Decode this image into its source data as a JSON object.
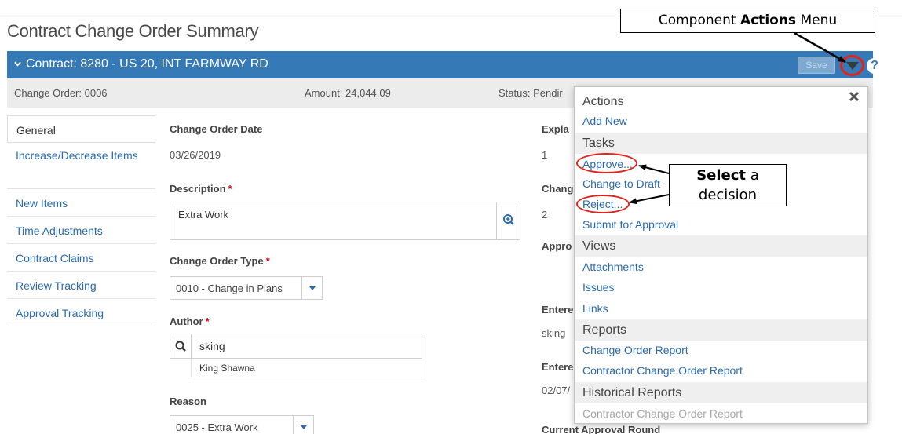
{
  "page": {
    "title": "Contract Change Order Summary"
  },
  "contract_bar": {
    "title": "Contract: 8280 - US 20, INT FARMWAY RD",
    "save_label": "Save",
    "help_symbol": "?"
  },
  "info_bar": {
    "change_order": "Change Order: 0006",
    "amount": "Amount: 24,044.09",
    "status": "Status: Pendir"
  },
  "nav": [
    {
      "label": "General"
    },
    {
      "label": "Increase/Decrease Items"
    },
    {
      "label": "New Items"
    },
    {
      "label": "Time Adjustments"
    },
    {
      "label": "Contract Claims"
    },
    {
      "label": "Review Tracking"
    },
    {
      "label": "Approval Tracking"
    }
  ],
  "form": {
    "change_order_date_label": "Change Order Date",
    "change_order_date": "03/26/2019",
    "description_label": "Description",
    "description": "Extra Work",
    "type_label": "Change Order Type",
    "type_value": "0010 - Change in Plans",
    "author_label": "Author",
    "author_value": "sking",
    "author_name": "King Shawna",
    "reason_label": "Reason",
    "reason_value": "0025 - Extra Work",
    "required_mark": "*"
  },
  "right_column": {
    "explanation_label": "Expla",
    "explanation_value": "1",
    "change_label": "Chang",
    "change_value": "2",
    "approval_label": "Appro",
    "entered_by_label": "Entere",
    "entered_by_value": "sking",
    "entered_date_label": "Entere",
    "entered_date_value": "02/07/",
    "round_label": "Current Approval Round"
  },
  "actions_menu": {
    "header": "Actions",
    "actions": [
      "Add New"
    ],
    "tasks_header": "Tasks",
    "tasks": [
      "Approve...",
      "Change to Draft",
      "Reject...",
      "Submit for Approval"
    ],
    "views_header": "Views",
    "views": [
      "Attachments",
      "Issues",
      "Links"
    ],
    "reports_header": "Reports",
    "reports": [
      "Change Order Report",
      "Contractor Change Order Report"
    ],
    "historical_header": "Historical Reports",
    "historical": [
      "Contractor Change Order Report"
    ]
  },
  "callouts": {
    "menu_prefix": "Component ",
    "menu_bold": "Actions",
    "menu_suffix": " Menu",
    "select_bold": "Select",
    "select_rest": " a",
    "select_line2": "decision"
  },
  "colors": {
    "header_blue": "#357ab7",
    "link_blue": "#2a6bb0",
    "highlight_red": "#e2231a",
    "required_red": "#d0021b"
  }
}
